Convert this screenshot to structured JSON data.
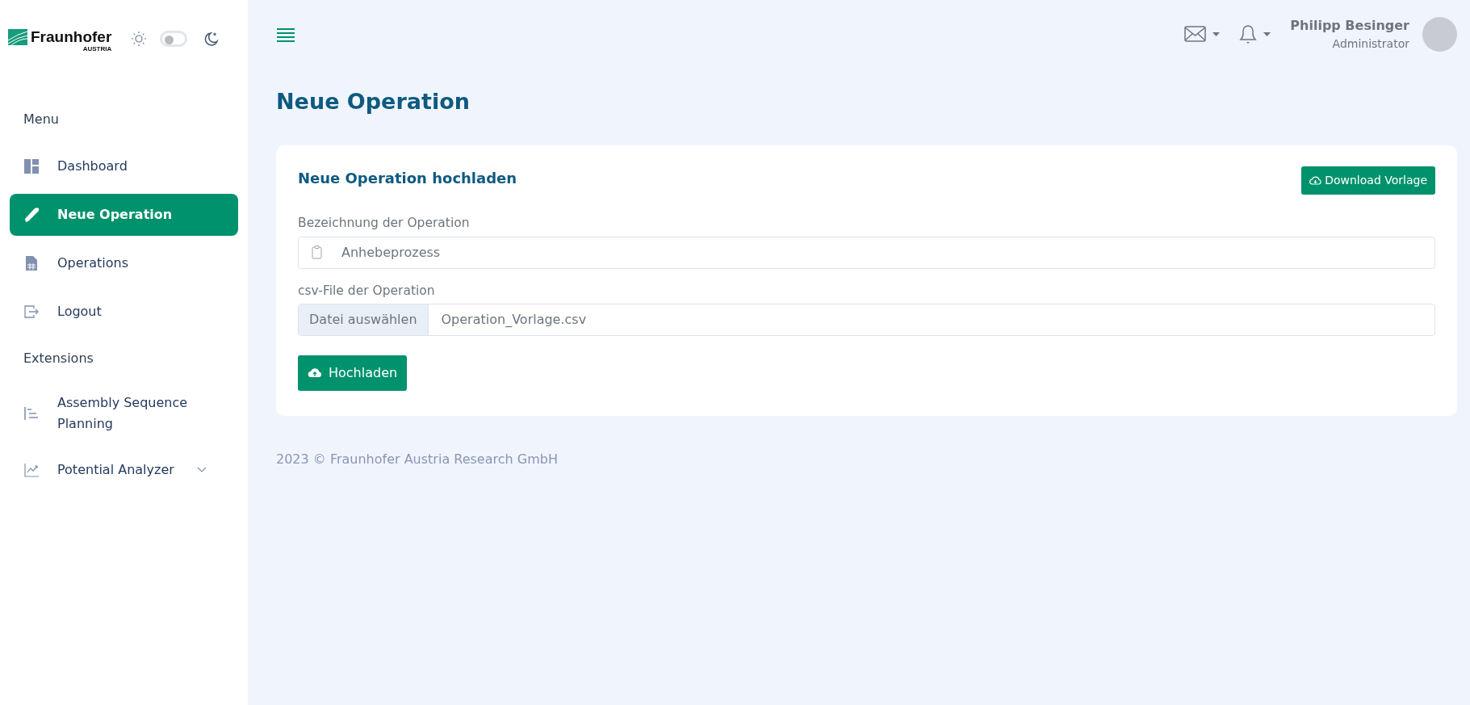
{
  "sidebar": {
    "logo": {
      "name": "Fraunhofer",
      "subtitle": "AUSTRIA"
    },
    "dark_mode": false,
    "sections": [
      {
        "title": "Menu",
        "items": [
          {
            "label": "Dashboard",
            "kind": "link",
            "selected": false
          },
          {
            "label": "Neue Operation",
            "kind": "link",
            "selected": true
          },
          {
            "label": "Operations",
            "kind": "link",
            "selected": false
          },
          {
            "label": "Logout",
            "kind": "link",
            "selected": false
          }
        ]
      },
      {
        "title": "Extensions",
        "items": [
          {
            "label": "Assembly Sequence Planning",
            "kind": "link",
            "selected": false
          },
          {
            "label": "Potential Analyzer",
            "kind": "group",
            "selected": false
          }
        ]
      }
    ]
  },
  "header": {
    "user": {
      "name": "Philipp Besinger",
      "role": "Administrator"
    }
  },
  "page": {
    "title": "Neue Operation"
  },
  "card": {
    "title": "Neue Operation hochladen",
    "download_button": "Download Vorlage",
    "fields": [
      {
        "kind": "text",
        "label": "Bezeichnung der Operation",
        "value": "Anhebeprozess"
      },
      {
        "kind": "file",
        "label": "csv-File der Operation",
        "button": "Datei auswählen",
        "value": "Operation_Vorlage.csv"
      }
    ],
    "submit_button": "Hochladen"
  },
  "footer": "2023 © Fraunhofer Austria Research GmbH"
}
